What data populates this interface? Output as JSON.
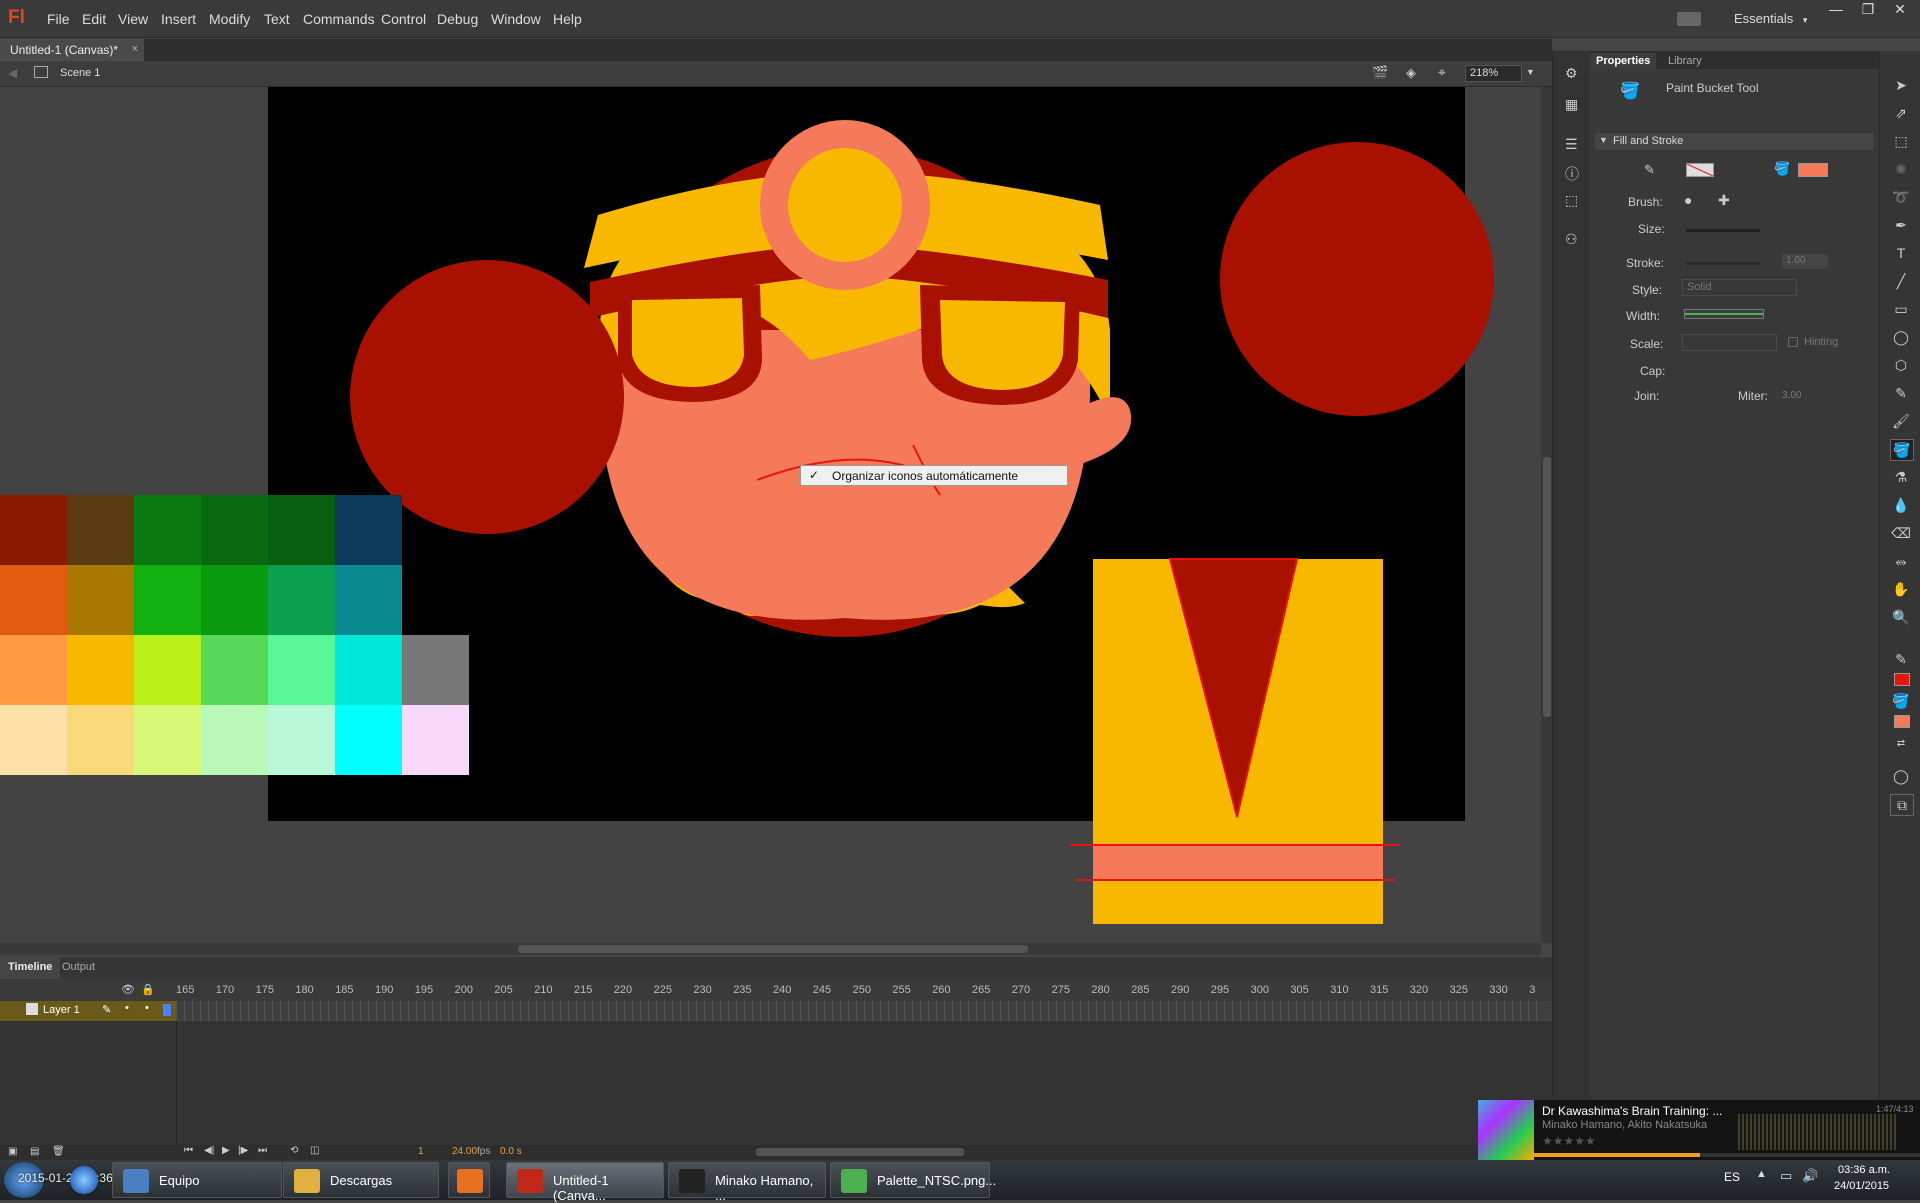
{
  "app": {
    "logo": "Fl",
    "menu": [
      "File",
      "Edit",
      "View",
      "Insert",
      "Modify",
      "Text",
      "Commands",
      "Control",
      "Debug",
      "Window",
      "Help"
    ],
    "workspace": "Essentials",
    "window_controls": [
      "—",
      "❐",
      "✕"
    ]
  },
  "document": {
    "tab_title": "Untitled-1 (Canvas)*",
    "tab_close": "×",
    "scene": "Scene 1",
    "zoom": "218%"
  },
  "context_menu": {
    "check": "✓",
    "label": "Organizar iconos automáticamente"
  },
  "timeline": {
    "tabs": [
      "Timeline",
      "Output"
    ],
    "frame_numbers": [
      "165",
      "170",
      "175",
      "180",
      "185",
      "190",
      "195",
      "200",
      "205",
      "210",
      "215",
      "220",
      "225",
      "230",
      "235",
      "240",
      "245",
      "250",
      "255",
      "260",
      "265",
      "270",
      "275",
      "280",
      "285",
      "290",
      "295",
      "300",
      "305",
      "310",
      "315",
      "320",
      "325",
      "330",
      "3"
    ],
    "layer_name": "Layer 1",
    "current_frame": "1",
    "fps": "24.00",
    "fps_unit": "fps",
    "elapsed": "0.0 s"
  },
  "properties": {
    "tabs": [
      "Properties",
      "Library"
    ],
    "tool_name": "Paint Bucket Tool",
    "section": "Fill and Stroke",
    "fill_color": "#f47a5a",
    "labels": {
      "brush": "Brush:",
      "size": "Size:",
      "stroke": "Stroke:",
      "stroke_value": "1.00",
      "style": "Style:",
      "style_value": "Solid",
      "width": "Width:",
      "scale": "Scale:",
      "hinting": "Hinting",
      "cap": "Cap:",
      "join": "Join:",
      "miter": "Miter:",
      "miter_value": "3.00"
    }
  },
  "tools": {
    "stroke_color": "#e8140c",
    "fill_color": "#f47a5a"
  },
  "music": {
    "title": "Dr Kawashima's Brain Training: ...",
    "artist": "Minako Hamano, Akito Nakatsuka",
    "time": "1:47/4:13"
  },
  "taskbar": {
    "overlay_timestamp": "2015-01-24 03:36:40 PM",
    "items": [
      {
        "label": "Equipo",
        "icon_color": "#4a7fc0"
      },
      {
        "label": "Descargas",
        "icon_color": "#e0b040"
      },
      {
        "label": "",
        "icon_color": "#e87020"
      },
      {
        "label": "Untitled-1 (Canva...",
        "icon_color": "#c0281a"
      },
      {
        "label": "Minako Hamano, ...",
        "icon_color": "#222"
      },
      {
        "label": "Palette_NTSC.png...",
        "icon_color": "#4caf50"
      }
    ],
    "language": "ES",
    "time": "03:36 a.m.",
    "date": "24/01/2015"
  },
  "palette": {
    "rows": [
      [
        "#8a1a00",
        "#5a3a10",
        "#0a7a10",
        "#086a10",
        "#066010",
        "#0a3a5a"
      ],
      [
        "#e05a10",
        "#a87800",
        "#10b010",
        "#0a9a10",
        "#0aa050",
        "#0a8a90"
      ],
      [
        "#ff9a40",
        "#f8b800",
        "#b8f018",
        "#58d858",
        "#58f898",
        "#00e8d8",
        "#787878"
      ],
      [
        "#ffe0a8",
        "#f8d878",
        "#d8f878",
        "#b8f8b8",
        "#b8f8d8",
        "#00ffff",
        "#f8d8f8"
      ]
    ]
  }
}
